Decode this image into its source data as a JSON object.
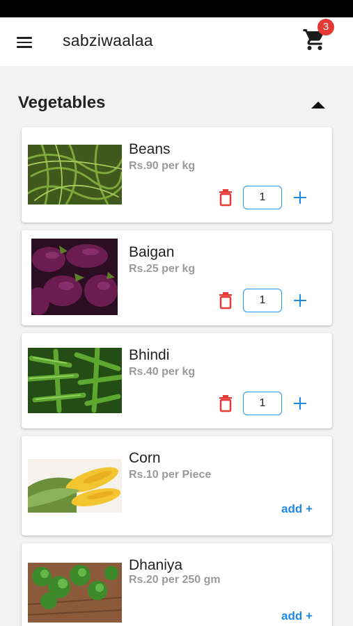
{
  "app": {
    "title": "sabziwaalaa",
    "cart_count": "3"
  },
  "section": {
    "title": "Vegetables"
  },
  "colors": {
    "accent": "#1e88e5",
    "delete": "#e53935",
    "badge": "#e53935",
    "price_text": "#9a9a9a"
  },
  "icons": {
    "menu": "menu-icon",
    "cart": "cart-icon",
    "collapse": "arrow-up-icon",
    "delete": "delete-icon",
    "increment": "plus-icon"
  },
  "products": [
    {
      "name": "Beans",
      "price": "Rs.90 per kg",
      "quantity": "1",
      "image": "beans-image"
    },
    {
      "name": "Baigan",
      "price": "Rs.25 per kg",
      "quantity": "1",
      "image": "eggplant-image"
    },
    {
      "name": "Bhindi",
      "price": "Rs.40 per kg",
      "quantity": "1",
      "image": "okra-image"
    },
    {
      "name": "Corn",
      "price": "Rs.10 per Piece",
      "add_label": "add +",
      "image": "corn-image"
    },
    {
      "name": "Dhaniya",
      "price": "Rs.20 per 250 gm",
      "add_label": "add +",
      "image": "coriander-image"
    }
  ]
}
